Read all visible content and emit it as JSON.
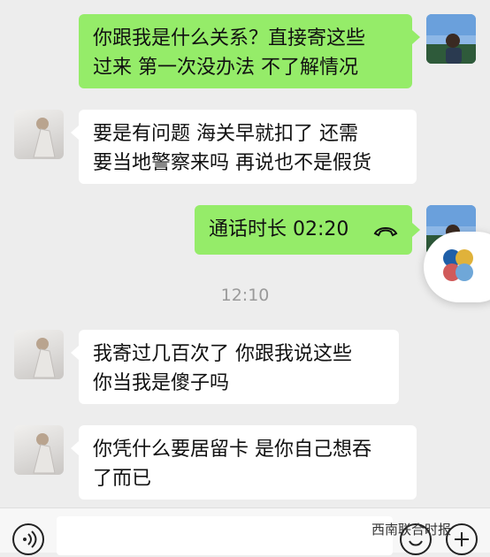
{
  "messages": [
    {
      "side": "right",
      "text": "你跟我是什么关系？直接寄这些\n过来  第一次没办法  不了解情况"
    },
    {
      "side": "left",
      "text": "要是有问题 海关早就扣了 还需\n要当地警察来吗 再说也不是假货"
    },
    {
      "side": "right",
      "call_label": "通话时长 02:20"
    },
    {
      "side": "left",
      "text": "我寄过几百次了 你跟我说这些\n你当我是傻子吗"
    },
    {
      "side": "left",
      "text": "你凭什么要居留卡 是你自己想吞\n了而已"
    }
  ],
  "timestamp": "12:10",
  "watermark": "西南联合时报",
  "icons": {
    "voice": "voice-icon",
    "emoji": "emoji-icon",
    "plus": "plus-icon",
    "call": "phone-hangup-icon",
    "floating": "floating-window-icon"
  },
  "colors": {
    "background": "#ededed",
    "self_bubble": "#95ec69",
    "other_bubble": "#ffffff",
    "time_text": "#9a9a9a"
  }
}
